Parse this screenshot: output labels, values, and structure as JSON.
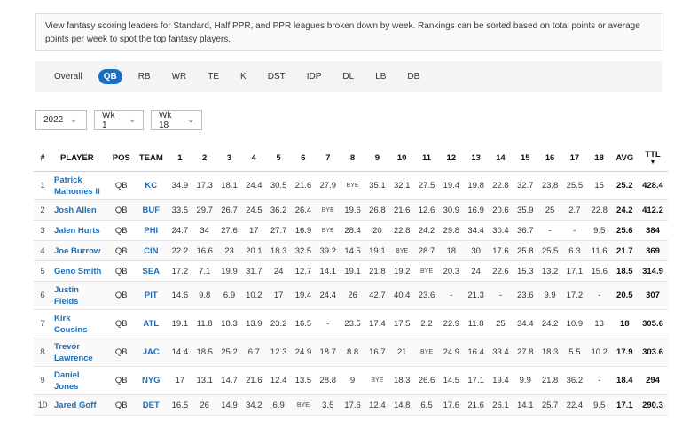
{
  "info_text": "View fantasy scoring leaders for Standard, Half PPR, and PPR leagues broken down by week. Rankings can be sorted based on total points or average points per week to spot the top fantasy players.",
  "tabs": [
    {
      "label": "Overall",
      "active": false
    },
    {
      "label": "QB",
      "active": true
    },
    {
      "label": "RB",
      "active": false
    },
    {
      "label": "WR",
      "active": false
    },
    {
      "label": "TE",
      "active": false
    },
    {
      "label": "K",
      "active": false
    },
    {
      "label": "DST",
      "active": false
    },
    {
      "label": "IDP",
      "active": false
    },
    {
      "label": "DL",
      "active": false
    },
    {
      "label": "LB",
      "active": false
    },
    {
      "label": "DB",
      "active": false
    }
  ],
  "filters": {
    "season": "2022",
    "week_start": "Wk 1",
    "week_end": "Wk 18"
  },
  "columns": [
    "#",
    "PLAYER",
    "POS",
    "TEAM",
    "1",
    "2",
    "3",
    "4",
    "5",
    "6",
    "7",
    "8",
    "9",
    "10",
    "11",
    "12",
    "13",
    "14",
    "15",
    "16",
    "17",
    "18",
    "AVG",
    "TTL"
  ],
  "rows": [
    {
      "rank": "1",
      "player": "Patrick Mahomes II",
      "pos": "QB",
      "team": "KC",
      "weeks": [
        "34.9",
        "17.3",
        "18.1",
        "24.4",
        "30.5",
        "21.6",
        "27.9",
        "BYE",
        "35.1",
        "32.1",
        "27.5",
        "19.4",
        "19.8",
        "22.8",
        "32.7",
        "23.8",
        "25.5",
        "15"
      ],
      "avg": "25.2",
      "ttl": "428.4"
    },
    {
      "rank": "2",
      "player": "Josh Allen",
      "pos": "QB",
      "team": "BUF",
      "weeks": [
        "33.5",
        "29.7",
        "26.7",
        "24.5",
        "36.2",
        "26.4",
        "BYE",
        "19.6",
        "26.8",
        "21.6",
        "12.6",
        "30.9",
        "16.9",
        "20.6",
        "35.9",
        "25",
        "2.7",
        "22.8"
      ],
      "avg": "24.2",
      "ttl": "412.2"
    },
    {
      "rank": "3",
      "player": "Jalen Hurts",
      "pos": "QB",
      "team": "PHI",
      "weeks": [
        "24.7",
        "34",
        "27.6",
        "17",
        "27.7",
        "16.9",
        "BYE",
        "28.4",
        "20",
        "22.8",
        "24.2",
        "29.8",
        "34.4",
        "30.4",
        "36.7",
        "-",
        "-",
        "9.5"
      ],
      "avg": "25.6",
      "ttl": "384"
    },
    {
      "rank": "4",
      "player": "Joe Burrow",
      "pos": "QB",
      "team": "CIN",
      "weeks": [
        "22.2",
        "16.6",
        "23",
        "20.1",
        "18.3",
        "32.5",
        "39.2",
        "14.5",
        "19.1",
        "BYE",
        "28.7",
        "18",
        "30",
        "17.6",
        "25.8",
        "25.5",
        "6.3",
        "11.6"
      ],
      "avg": "21.7",
      "ttl": "369"
    },
    {
      "rank": "5",
      "player": "Geno Smith",
      "pos": "QB",
      "team": "SEA",
      "weeks": [
        "17.2",
        "7.1",
        "19.9",
        "31.7",
        "24",
        "12.7",
        "14.1",
        "19.1",
        "21.8",
        "19.2",
        "BYE",
        "20.3",
        "24",
        "22.6",
        "15.3",
        "13.2",
        "17.1",
        "15.6"
      ],
      "avg": "18.5",
      "ttl": "314.9"
    },
    {
      "rank": "6",
      "player": "Justin Fields",
      "pos": "QB",
      "team": "PIT",
      "weeks": [
        "14.6",
        "9.8",
        "6.9",
        "10.2",
        "17",
        "19.4",
        "24.4",
        "26",
        "42.7",
        "40.4",
        "23.6",
        "-",
        "21.3",
        "-",
        "23.6",
        "9.9",
        "17.2",
        "-"
      ],
      "avg": "20.5",
      "ttl": "307"
    },
    {
      "rank": "7",
      "player": "Kirk Cousins",
      "pos": "QB",
      "team": "ATL",
      "weeks": [
        "19.1",
        "11.8",
        "18.3",
        "13.9",
        "23.2",
        "16.5",
        "-",
        "23.5",
        "17.4",
        "17.5",
        "2.2",
        "22.9",
        "11.8",
        "25",
        "34.4",
        "24.2",
        "10.9",
        "13"
      ],
      "avg": "18",
      "ttl": "305.6"
    },
    {
      "rank": "8",
      "player": "Trevor Lawrence",
      "pos": "QB",
      "team": "JAC",
      "weeks": [
        "14.4",
        "18.5",
        "25.2",
        "6.7",
        "12.3",
        "24.9",
        "18.7",
        "8.8",
        "16.7",
        "21",
        "BYE",
        "24.9",
        "16.4",
        "33.4",
        "27.8",
        "18.3",
        "5.5",
        "10.2"
      ],
      "avg": "17.9",
      "ttl": "303.6"
    },
    {
      "rank": "9",
      "player": "Daniel Jones",
      "pos": "QB",
      "team": "NYG",
      "weeks": [
        "17",
        "13.1",
        "14.7",
        "21.6",
        "12.4",
        "13.5",
        "28.8",
        "9",
        "BYE",
        "18.3",
        "26.6",
        "14.5",
        "17.1",
        "19.4",
        "9.9",
        "21.8",
        "36.2",
        "-"
      ],
      "avg": "18.4",
      "ttl": "294"
    },
    {
      "rank": "10",
      "player": "Jared Goff",
      "pos": "QB",
      "team": "DET",
      "weeks": [
        "16.5",
        "26",
        "14.9",
        "34.2",
        "6.9",
        "BYE",
        "3.5",
        "17.6",
        "12.4",
        "14.8",
        "6.5",
        "17.6",
        "21.6",
        "26.1",
        "14.1",
        "25.7",
        "22.4",
        "9.5"
      ],
      "avg": "17.1",
      "ttl": "290.3"
    }
  ]
}
